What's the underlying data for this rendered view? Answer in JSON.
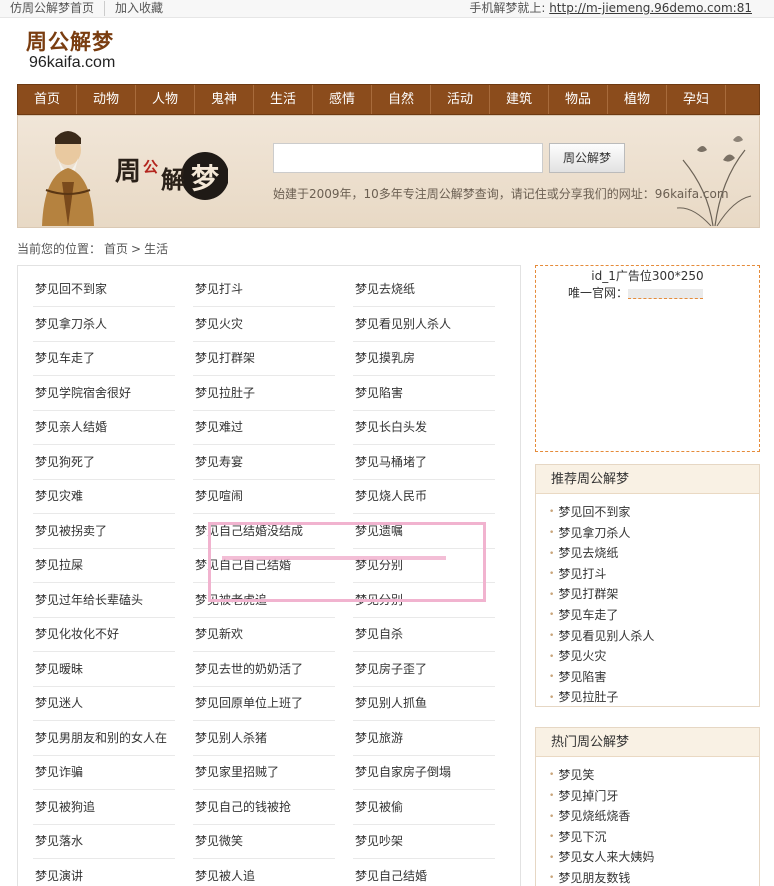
{
  "topbar": {
    "home_link": "仿周公解梦首页",
    "favorite_link": "加入收藏",
    "mobile_label": "手机解梦就上: ",
    "mobile_url": "http://m-jiemeng.96demo.com:81"
  },
  "logo": {
    "cn": "周公解梦",
    "en": "96kaifa.com"
  },
  "nav": [
    "首页",
    "动物",
    "人物",
    "鬼神",
    "生活",
    "感情",
    "自然",
    "活动",
    "建筑",
    "物品",
    "植物",
    "孕妇"
  ],
  "banner": {
    "title_art": "周公解梦",
    "search_button": "周公解梦",
    "slogan": "始建于2009年，10多年专注周公解梦查询，请记住或分享我们的网址：96kaifa.com"
  },
  "breadcrumb": {
    "prefix": "当前您的位置：",
    "home": "首页",
    "sep": ">",
    "current": "生活"
  },
  "dreams": [
    "梦见回不到家",
    "梦见打斗",
    "梦见去烧纸",
    "梦见拿刀杀人",
    "梦见火灾",
    "梦见看见别人杀人",
    "梦见车走了",
    "梦见打群架",
    "梦见摸乳房",
    "梦见学院宿舍很好",
    "梦见拉肚子",
    "梦见陷害",
    "梦见亲人结婚",
    "梦见难过",
    "梦见长白头发",
    "梦见狗死了",
    "梦见寿宴",
    "梦见马桶堵了",
    "梦见灾难",
    "梦见喧闹",
    "梦见烧人民币",
    "梦见被拐卖了",
    "梦见自己结婚没结成",
    "梦见遗嘱",
    "梦见拉屎",
    "梦见自己自己结婚",
    "梦见分别",
    "梦见过年给长辈磕头",
    "梦见被老虎追",
    "梦见分别",
    "梦见化妆化不好",
    "梦见新欢",
    "梦见自杀",
    "梦见暧昧",
    "梦见去世的奶奶活了",
    "梦见房子歪了",
    "梦见迷人",
    "梦见回原单位上班了",
    "梦见别人抓鱼",
    "梦见男朋友和别的女人在",
    "梦见别人杀猪",
    "梦见旅游",
    "梦见诈骗",
    "梦见家里招贼了",
    "梦见自家房子倒塌",
    "梦见被狗追",
    "梦见自己的钱被抢",
    "梦见被偷",
    "梦见落水",
    "梦见微笑",
    "梦见吵架",
    "梦见演讲",
    "梦见被人追",
    "梦见自己结婚"
  ],
  "ad": {
    "line1": "id_1广告位300*250",
    "line2": "唯一官网："
  },
  "recommend": {
    "title": "推荐周公解梦",
    "items": [
      "梦见回不到家",
      "梦见拿刀杀人",
      "梦见去烧纸",
      "梦见打斗",
      "梦见打群架",
      "梦见车走了",
      "梦见看见别人杀人",
      "梦见火灾",
      "梦见陷害",
      "梦见拉肚子"
    ]
  },
  "hot": {
    "title": "热门周公解梦",
    "items": [
      "梦见笑",
      "梦见掉门牙",
      "梦见烧纸烧香",
      "梦见下沉",
      "梦见女人来大姨妈",
      "梦见朋友数钱"
    ]
  },
  "colors": {
    "nav_bg": "#8b4c1c",
    "accent": "#7a3d10",
    "ad_border": "#e58b3a",
    "overlay_pink": "#f1b3cf"
  }
}
